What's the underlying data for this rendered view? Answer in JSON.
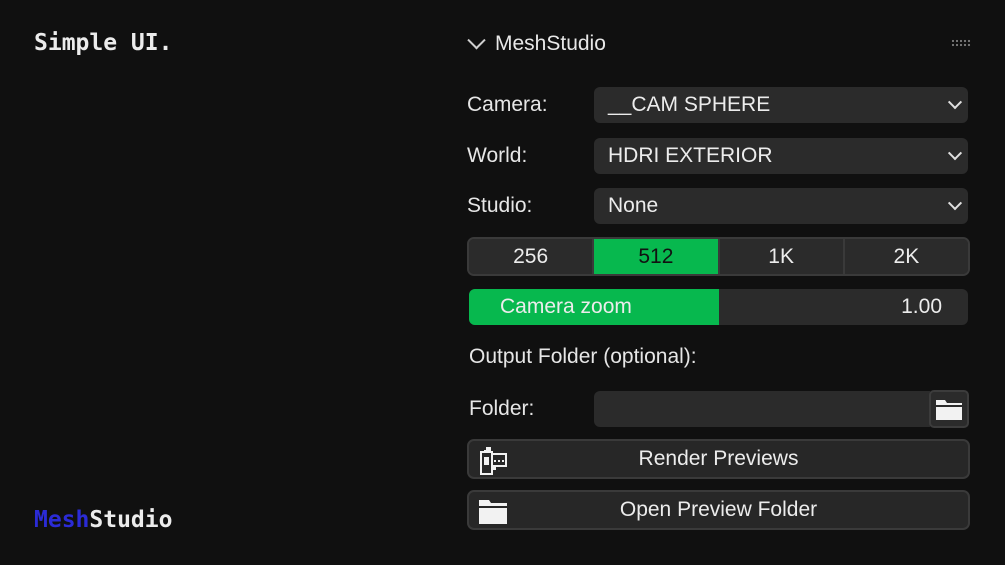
{
  "brand": {
    "tagline": "Simple UI.",
    "logo_part1": "Mesh",
    "logo_part2": "Studio"
  },
  "panel": {
    "title": "MeshStudio",
    "icons": {
      "collapse": "chevron-down-icon",
      "drag": "drag-handle-icon",
      "dropdown": "chevron-down-icon",
      "folder": "folder-icon",
      "render": "film-camera-icon"
    },
    "camera": {
      "label": "Camera:",
      "value": "__CAM SPHERE"
    },
    "world": {
      "label": "World:",
      "value": "HDRI EXTERIOR"
    },
    "studio": {
      "label": "Studio:",
      "value": "None"
    },
    "resolution": {
      "options": [
        "256",
        "512",
        "1K",
        "2K"
      ],
      "selected": "512"
    },
    "zoom": {
      "label": "Camera zoom",
      "value": "1.00",
      "fill_fraction": 0.5
    },
    "output_section_label": "Output Folder (optional):",
    "folder": {
      "label": "Folder:",
      "value": ""
    },
    "render_button": "Render Previews",
    "open_folder_button": "Open Preview Folder"
  },
  "colors": {
    "background": "#101010",
    "accent_green": "#07b84e",
    "accent_blue": "#2b2bd6",
    "field": "#2b2b2b"
  }
}
